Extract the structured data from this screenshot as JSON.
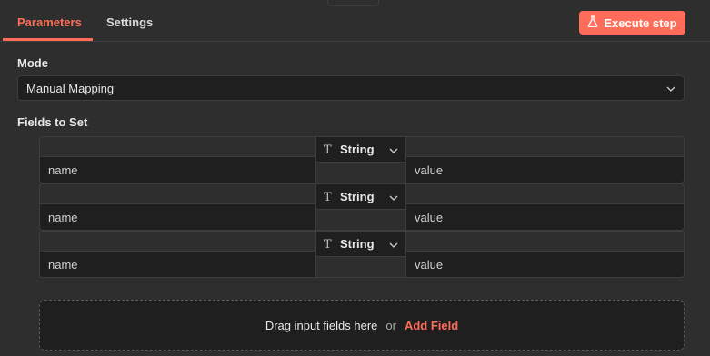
{
  "tabs": [
    {
      "label": "Parameters",
      "active": true
    },
    {
      "label": "Settings",
      "active": false
    }
  ],
  "execute_button": {
    "label": "Execute step",
    "icon": "flask-icon"
  },
  "mode": {
    "label": "Mode",
    "selected": "Manual Mapping"
  },
  "fields": {
    "label": "Fields to Set",
    "rows": [
      {
        "name_placeholder": "name",
        "type": "String",
        "value_placeholder": "value"
      },
      {
        "name_placeholder": "name",
        "type": "String",
        "value_placeholder": "value"
      },
      {
        "name_placeholder": "name",
        "type": "String",
        "value_placeholder": "value"
      }
    ]
  },
  "dropzone": {
    "hint": "Drag input fields here",
    "or": "or",
    "add_label": "Add Field"
  },
  "colors": {
    "accent": "#ff6d5a",
    "background": "#2e2e2e",
    "input_bg": "#1f1f1f"
  }
}
